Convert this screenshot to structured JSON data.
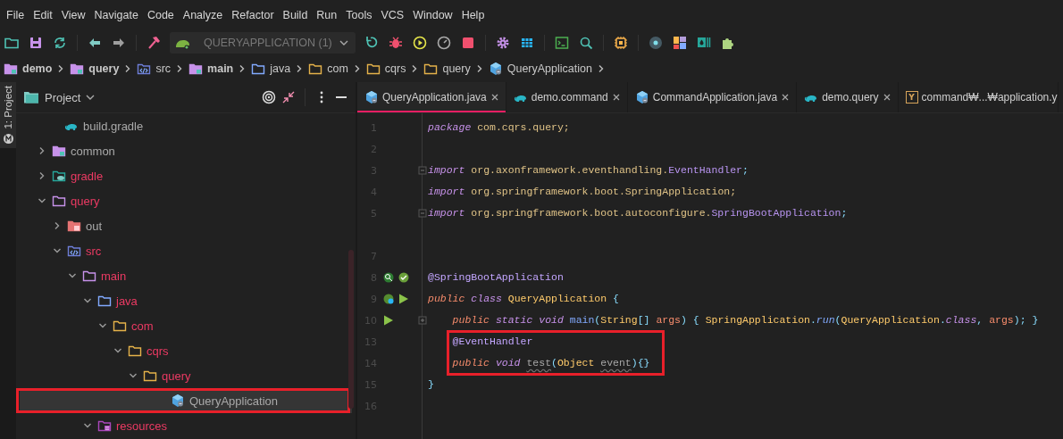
{
  "menu_bar": [
    "File",
    "Edit",
    "View",
    "Navigate",
    "Code",
    "Analyze",
    "Refactor",
    "Build",
    "Run",
    "Tools",
    "VCS",
    "Window",
    "Help"
  ],
  "toolbar": {
    "run_config": "QUERYAPPLICATION (1)"
  },
  "breadcrumbs": [
    {
      "label": "demo",
      "kind": "module"
    },
    {
      "label": "query",
      "kind": "module"
    },
    {
      "label": "src",
      "kind": "source_root"
    },
    {
      "label": "main",
      "kind": "module"
    },
    {
      "label": "java",
      "kind": "source_folder"
    },
    {
      "label": "com",
      "kind": "package"
    },
    {
      "label": "cqrs",
      "kind": "package"
    },
    {
      "label": "query",
      "kind": "package"
    },
    {
      "label": "QueryApplication",
      "kind": "class"
    }
  ],
  "tool_stripe": {
    "label": "1: Project"
  },
  "project_panel": {
    "title": "Project",
    "tree": [
      {
        "label": "build.gradle",
        "kind": "gradle_file",
        "color": "#a9a9a9",
        "selected": false
      },
      {
        "label": "common",
        "kind": "module",
        "color": "#a9a9a9",
        "expanded": false,
        "selected": false
      },
      {
        "label": "gradle",
        "kind": "gradle_folder",
        "color": "#ec3a63",
        "expanded": false,
        "selected": false
      },
      {
        "label": "query",
        "kind": "module_dir",
        "color": "#ec3a63",
        "expanded": true,
        "selected": false,
        "children": [
          {
            "label": "out",
            "kind": "excluded_folder",
            "color": "#a9a9a9",
            "expanded": false,
            "selected": false
          },
          {
            "label": "src",
            "kind": "source_root",
            "color": "#ec3a63",
            "expanded": true,
            "selected": false,
            "children": [
              {
                "label": "main",
                "kind": "module_dir",
                "color": "#ec3a63",
                "expanded": true,
                "selected": false,
                "children": [
                  {
                    "label": "java",
                    "kind": "source_folder",
                    "color": "#ec3a63",
                    "expanded": true,
                    "selected": false,
                    "children": [
                      {
                        "label": "com",
                        "kind": "package",
                        "color": "#ec3a63",
                        "expanded": true,
                        "selected": false,
                        "children": [
                          {
                            "label": "cqrs",
                            "kind": "package",
                            "color": "#ec3a63",
                            "expanded": true,
                            "selected": false,
                            "children": [
                              {
                                "label": "query",
                                "kind": "package",
                                "color": "#ec3a63",
                                "expanded": true,
                                "selected": false,
                                "children": [
                                  {
                                    "label": "QueryApplication",
                                    "kind": "class",
                                    "color": "#a9a9a9",
                                    "selected": true,
                                    "annotated": true
                                  }
                                ]
                              }
                            ]
                          }
                        ]
                      }
                    ]
                  },
                  {
                    "label": "resources",
                    "kind": "resources_root",
                    "color": "#ec3a63",
                    "expanded": true,
                    "selected": false
                  }
                ]
              }
            ]
          }
        ]
      }
    ]
  },
  "editor": {
    "tabs": [
      {
        "label": "QueryApplication.java",
        "kind": "class",
        "selected": true,
        "closable": true
      },
      {
        "label": "demo.command",
        "kind": "gradle_file",
        "selected": false,
        "closable": true
      },
      {
        "label": "CommandApplication.java",
        "kind": "class",
        "selected": false,
        "closable": true
      },
      {
        "label": "demo.query",
        "kind": "gradle_file",
        "selected": false,
        "closable": true
      },
      {
        "label": "command₩...₩application.y",
        "kind": "yaml",
        "badge": "Y",
        "selected": false,
        "closable": false
      }
    ],
    "lines": [
      {
        "number": "1",
        "tokens": [
          {
            "text": "package",
            "kind": "keyword"
          },
          {
            "text": " com.cqrs.query;",
            "kind": "ident"
          }
        ]
      },
      {
        "number": "2"
      },
      {
        "number": "3",
        "collapsed": false,
        "tokens": [
          {
            "text": "import",
            "kind": "keyword"
          },
          {
            "text": " org.axonframework.eventhandling.",
            "kind": "ident"
          },
          {
            "text": "EventHandler",
            "kind": "type"
          },
          {
            "text": ";",
            "kind": "punct"
          }
        ]
      },
      {
        "number": "4",
        "tokens": [
          {
            "text": "import",
            "kind": "keyword"
          },
          {
            "text": " org.springframework.boot.",
            "kind": "ident"
          },
          {
            "text": "SpringApplication;",
            "kind": "ident"
          }
        ]
      },
      {
        "number": "5",
        "collapsed": false,
        "tokens": [
          {
            "text": "import",
            "kind": "keyword"
          },
          {
            "text": " org.springframework.boot.autoconfigure.",
            "kind": "ident"
          },
          {
            "text": "SpringBootApplication",
            "kind": "type"
          },
          {
            "text": ";",
            "kind": "punct"
          }
        ]
      },
      {
        "number": "7",
        "gap_before": true
      },
      {
        "number": "8",
        "gutter": [
          {
            "kind": "bean_search"
          },
          {
            "kind": "spring_check"
          }
        ],
        "tokens": [
          {
            "text": "@SpringBootApplication",
            "kind": "annotation"
          }
        ]
      },
      {
        "number": "9",
        "gutter": [
          {
            "kind": "spring_bean"
          },
          {
            "kind": "run"
          }
        ],
        "tokens": [
          {
            "text": "public",
            "kind": "modifier"
          },
          {
            "text": " class",
            "kind": "keyword"
          },
          {
            "text": " QueryApplication",
            "kind": "class_name"
          },
          {
            "text": " {",
            "kind": "punct"
          }
        ]
      },
      {
        "number": "10",
        "gutter": [
          {
            "kind": "run"
          }
        ],
        "collapsed": true,
        "tokens": [
          {
            "text": "    public",
            "kind": "modifier"
          },
          {
            "text": " static void",
            "kind": "keyword"
          },
          {
            "text": " main",
            "kind": "method"
          },
          {
            "text": "(",
            "kind": "punct"
          },
          {
            "text": "String",
            "kind": "class_name"
          },
          {
            "text": "[]",
            "kind": "punct"
          },
          {
            "text": " args",
            "kind": "param"
          },
          {
            "text": ") { ",
            "kind": "punct"
          },
          {
            "text": "SpringApplication",
            "kind": "class_name"
          },
          {
            "text": ".",
            "kind": "punct"
          },
          {
            "text": "run",
            "kind": "static_call"
          },
          {
            "text": "(",
            "kind": "punct"
          },
          {
            "text": "QueryApplication",
            "kind": "class_name"
          },
          {
            "text": ".",
            "kind": "punct"
          },
          {
            "text": "class",
            "kind": "keyword"
          },
          {
            "text": ", ",
            "kind": "punct"
          },
          {
            "text": "args",
            "kind": "param"
          },
          {
            "text": "); }",
            "kind": "punct"
          }
        ]
      },
      {
        "number": "13",
        "annotated": true,
        "tokens": [
          {
            "text": "    @EventHandler",
            "kind": "annotation"
          }
        ]
      },
      {
        "number": "14",
        "annotated": true,
        "tokens": [
          {
            "text": "    public",
            "kind": "modifier"
          },
          {
            "text": " void ",
            "kind": "keyword"
          },
          {
            "text": "test",
            "kind": "unused"
          },
          {
            "text": "(",
            "kind": "punct"
          },
          {
            "text": "Object ",
            "kind": "class_name"
          },
          {
            "text": "event",
            "kind": "unused"
          },
          {
            "text": "){}",
            "kind": "punct"
          }
        ]
      },
      {
        "number": "15",
        "tokens": [
          {
            "text": "}",
            "kind": "punct"
          }
        ]
      },
      {
        "number": "16"
      }
    ]
  }
}
